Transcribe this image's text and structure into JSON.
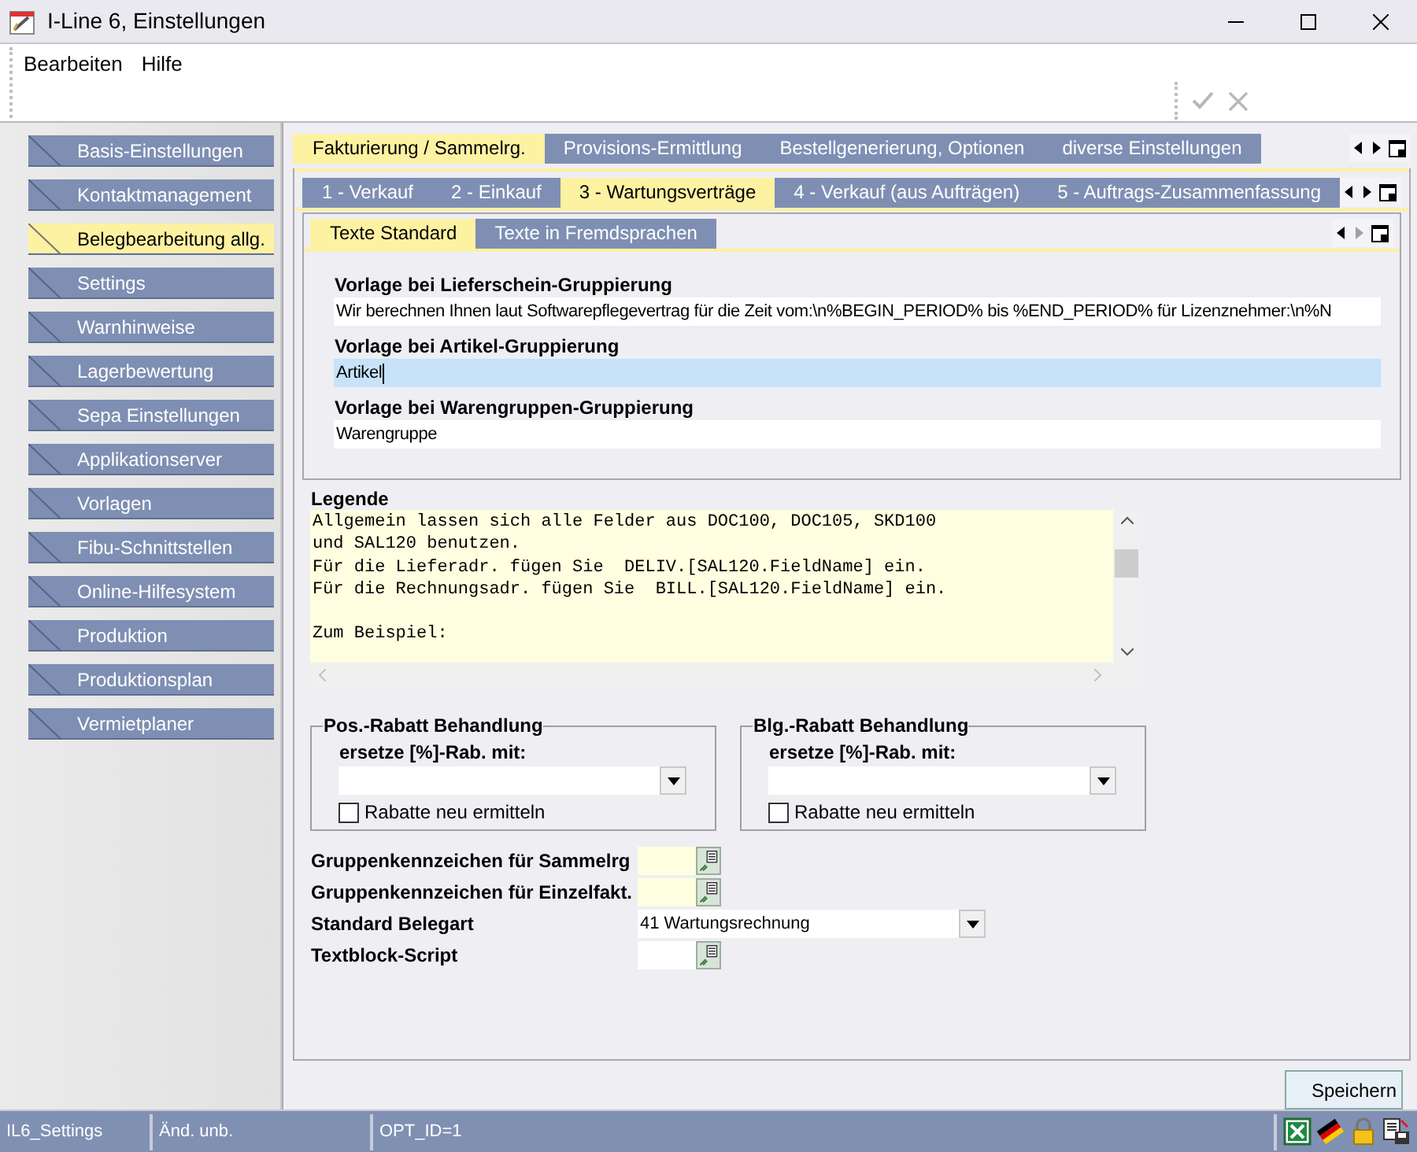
{
  "window": {
    "title": "I-Line 6, Einstellungen"
  },
  "menu": [
    {
      "label": "Bearbeiten"
    },
    {
      "label": "Hilfe"
    }
  ],
  "toolbar": [
    {
      "kind": "confirm",
      "disabled": true
    },
    {
      "kind": "cancel",
      "disabled": true
    }
  ],
  "sidebar": {
    "items": [
      {
        "label": "Basis-Einstellungen",
        "selected": false
      },
      {
        "label": "Kontaktmanagement",
        "selected": false
      },
      {
        "label": "Belegbearbeitung allg.",
        "selected": true
      },
      {
        "label": "Settings",
        "selected": false
      },
      {
        "label": "Warnhinweise",
        "selected": false
      },
      {
        "label": "Lagerbewertung",
        "selected": false
      },
      {
        "label": "Sepa Einstellungen",
        "selected": false
      },
      {
        "label": "Applikationserver",
        "selected": false
      },
      {
        "label": "Vorlagen",
        "selected": false
      },
      {
        "label": "Fibu-Schnittstellen",
        "selected": false
      },
      {
        "label": "Online-Hilfesystem",
        "selected": false
      },
      {
        "label": "Produktion",
        "selected": false
      },
      {
        "label": "Produktionsplan",
        "selected": false
      },
      {
        "label": "Vermietplaner",
        "selected": false
      }
    ]
  },
  "main_tabs": {
    "next_disabled": false,
    "tabs": [
      {
        "label": "Fakturierung / Sammelrg.",
        "selected": true
      },
      {
        "label": "Provisions-Ermittlung",
        "selected": false
      },
      {
        "label": "Bestellgenerierung, Optionen",
        "selected": false
      },
      {
        "label": "diverse Einstellungen",
        "selected": false
      }
    ]
  },
  "sub_tabs": {
    "next_disabled": false,
    "tabs": [
      {
        "label": "1 - Verkauf",
        "selected": false
      },
      {
        "label": "2 - Einkauf",
        "selected": false
      },
      {
        "label": "3 - Wartungsverträge",
        "selected": true
      },
      {
        "label": "4 - Verkauf (aus Aufträgen)",
        "selected": false
      },
      {
        "label": "5 - Auftrags-Zusammenfassung",
        "selected": false
      }
    ]
  },
  "text_tabs": {
    "next_disabled": true,
    "tabs": [
      {
        "label": "Texte Standard",
        "selected": true
      },
      {
        "label": "Texte in Fremdsprachen",
        "selected": false
      }
    ]
  },
  "templates": [
    {
      "label": "Vorlage bei Lieferschein-Gruppierung",
      "value": "Wir berechnen Ihnen laut Softwarepflegevertrag für die Zeit vom:\\n%BEGIN_PERIOD% bis %END_PERIOD%  für Lizenznehmer:\\n%N",
      "focused": false
    },
    {
      "label": "Vorlage bei Artikel-Gruppierung",
      "value": "Artikel",
      "focused": true
    },
    {
      "label": "Vorlage bei Warengruppen-Gruppierung",
      "value": "Warengruppe",
      "focused": false
    }
  ],
  "legend": {
    "label": "Legende",
    "text": "Allgemein lassen sich alle Felder aus DOC100, DOC105, SKD100\nund SAL120 benutzen.\nFür die Lieferadr. fügen Sie  DELIV.[SAL120.FieldName] ein.\nFür die Rechnungsadr. fügen Sie  BILL.[SAL120.FieldName] ein.\n\nZum Beispiel:"
  },
  "discount_groups": [
    {
      "title": "Pos.-Rabatt Behandlung",
      "field_label": "ersetze [%]-Rab.  mit:",
      "checkbox_label": "Rabatte neu ermitteln",
      "checked": false
    },
    {
      "title": "Blg.-Rabatt Behandlung",
      "field_label": "ersetze [%]-Rab.  mit:",
      "checkbox_label": "Rabatte neu ermitteln",
      "checked": false
    }
  ],
  "form_rows": [
    {
      "label": "Gruppenkennzeichen für Sammelrg",
      "kind": "lookup",
      "highlighted": true
    },
    {
      "label": "Gruppenkennzeichen für Einzelfakt.",
      "kind": "lookup",
      "highlighted": true
    },
    {
      "label": "Standard Belegart",
      "kind": "select",
      "value": "41 Wartungsrechnung"
    },
    {
      "label": "Textblock-Script",
      "kind": "lookup",
      "highlighted": false
    }
  ],
  "save_button": {
    "label": "Speichern"
  },
  "status_bar": [
    {
      "text": "IL6_Settings"
    },
    {
      "text": "Änd. unb."
    },
    {
      "text": "OPT_ID=1"
    }
  ]
}
